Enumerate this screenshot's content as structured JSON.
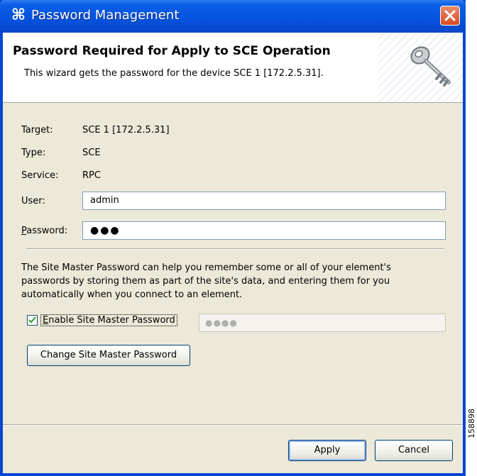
{
  "window": {
    "title": "Password Management",
    "app_icon": "cisco-scm-icon"
  },
  "header": {
    "title": "Password Required for Apply to SCE Operation",
    "description": "This wizard gets the password for the device SCE 1 [172.2.5.31].",
    "icon": "key-icon"
  },
  "form": {
    "target_label": "Target:",
    "target_value": "SCE 1 [172.2.5.31]",
    "type_label": "Type:",
    "type_value": "SCE",
    "service_label": "Service:",
    "service_value": "RPC",
    "user_label": "User:",
    "user_value": "admin",
    "password_label_mnemonic": "P",
    "password_label_rest": "assword:",
    "password_value": "●●●"
  },
  "site_master": {
    "info": "The Site Master Password can help you remember some or all of your element's passwords by storing them as part of the site's data, and entering them for you automatically when you connect to an element.",
    "enable_label_mnemonic": "E",
    "enable_label_rest": "nable Site Master Password",
    "enabled": true,
    "master_password_value": "●●●●",
    "change_button": "Change Site Master Password"
  },
  "footer": {
    "apply_button": "Apply",
    "cancel_button": "Cancel"
  },
  "figure_id": "158898",
  "colors": {
    "titlebar": "#0552de",
    "dialog_bg": "#ece9d8",
    "close_button": "#d84a20"
  }
}
